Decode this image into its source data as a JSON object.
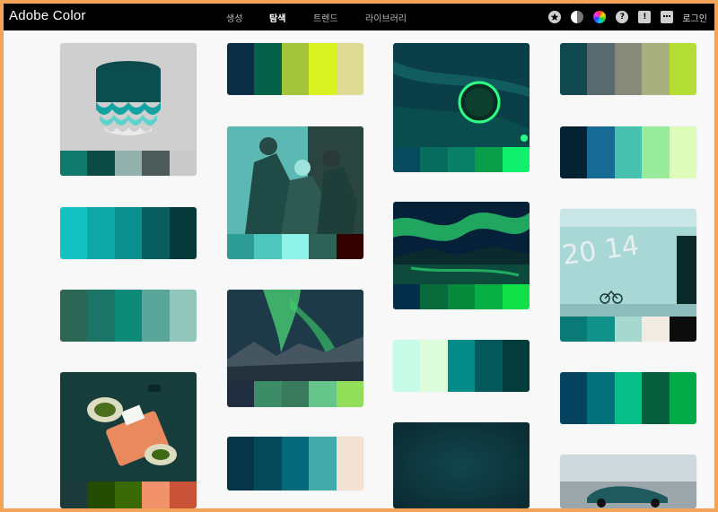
{
  "app": {
    "title": "Adobe Color"
  },
  "nav": [
    {
      "label": "생성",
      "active": false
    },
    {
      "label": "탐색",
      "active": true
    },
    {
      "label": "트렌드",
      "active": false
    },
    {
      "label": "라이브러리",
      "active": false
    }
  ],
  "header_icons": [
    "star-icon",
    "contrast-icon",
    "color-wheel-icon",
    "help-icon",
    "feedback-icon",
    "chat-icon"
  ],
  "header_icon_glyphs": {
    "help": "?",
    "feedback": "!"
  },
  "login_label": "로그인",
  "palettes": [
    {
      "id": "col1-product-mug",
      "image": "product-mug-scalloped",
      "colors": [
        "#0f7a6b",
        "#0a4a42",
        "#92b2ae",
        "#4c5a59",
        "#c9c9c9"
      ]
    },
    {
      "id": "col1-solid-teal",
      "image": null,
      "colors": [
        "#13c2c2",
        "#0fa8a8",
        "#0b8f8f",
        "#085e5e",
        "#053838"
      ]
    },
    {
      "id": "col1-solid-green",
      "image": null,
      "colors": [
        "#2c6655",
        "#1b7566",
        "#0c8a78",
        "#5aa599",
        "#93c6bb"
      ]
    },
    {
      "id": "col1-plant-stone",
      "image": "plant-leaves-stone",
      "colors": [
        "#1a3a3c",
        "#254b00",
        "#3a6a05",
        "#f2926b",
        "#c95238"
      ]
    },
    {
      "id": "col2-solid-lime",
      "image": null,
      "colors": [
        "#0b2e45",
        "#056147",
        "#a4c53a",
        "#d8f221",
        "#dddb96"
      ]
    },
    {
      "id": "col2-illustration-band",
      "image": "illustration-band",
      "colors": [
        "#2d9d96",
        "#4dc6bd",
        "#8ef4e9",
        "#2e6256",
        "#330000"
      ]
    },
    {
      "id": "col2-aurora-mountains",
      "image": "aurora-mountains",
      "colors": [
        "#1f2d3e",
        "#3d8c68",
        "#3a7a5c",
        "#66c58a",
        "#92dd5a"
      ]
    },
    {
      "id": "col2-solid-ocean",
      "image": null,
      "colors": [
        "#053548",
        "#054a5b",
        "#066a7a",
        "#44a9a9",
        "#f2e2d4"
      ]
    },
    {
      "id": "col3-space-planet",
      "image": "space-planet",
      "colors": [
        "#064a5e",
        "#076b5d",
        "#0a7f67",
        "#0b9e4a",
        "#11f06c"
      ]
    },
    {
      "id": "col3-aurora-lake",
      "image": "aurora-lake",
      "colors": [
        "#042e4a",
        "#066a3b",
        "#058a3c",
        "#06b045",
        "#0ee045"
      ]
    },
    {
      "id": "col3-solid-mint",
      "image": null,
      "colors": [
        "#c8fae8",
        "#dcfcdc",
        "#058a8a",
        "#045a5a",
        "#043c3c"
      ]
    },
    {
      "id": "col3-dark-texture",
      "image": "dark-teal-texture",
      "colors": []
    },
    {
      "id": "col4-solid-olive",
      "image": null,
      "colors": [
        "#104a4f",
        "#586a6e",
        "#878a7a",
        "#a7b07e",
        "#b4de36"
      ]
    },
    {
      "id": "col4-solid-blue-mint",
      "image": null,
      "colors": [
        "#052232",
        "#176a94",
        "#48c2b0",
        "#98eb9a",
        "#ddfbb9"
      ]
    },
    {
      "id": "col4-building-2014",
      "image": "building-2014-bike",
      "colors": [
        "#0a7a77",
        "#10928a",
        "#a6d8ce",
        "#f2ebe3",
        "#0c0c0c"
      ]
    },
    {
      "id": "col4-solid-emerald",
      "image": null,
      "colors": [
        "#064361",
        "#03707a",
        "#06c087",
        "#055e3e",
        "#05aa48"
      ]
    },
    {
      "id": "col4-car-road",
      "image": "car-on-road",
      "colors": []
    }
  ]
}
